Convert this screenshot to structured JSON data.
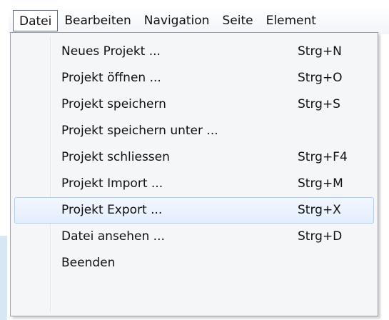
{
  "menubar": {
    "items": [
      {
        "label": "Datei"
      },
      {
        "label": "Bearbeiten"
      },
      {
        "label": "Navigation"
      },
      {
        "label": "Seite"
      },
      {
        "label": "Element"
      }
    ]
  },
  "dropdown": {
    "items": [
      {
        "label": "Neues Projekt ...",
        "shortcut": "Strg+N"
      },
      {
        "label": "Projekt öffnen ...",
        "shortcut": "Strg+O"
      },
      {
        "label": "Projekt speichern",
        "shortcut": "Strg+S"
      },
      {
        "label": "Projekt speichern unter ...",
        "shortcut": ""
      },
      {
        "label": "Projekt schliessen",
        "shortcut": "Strg+F4"
      },
      {
        "label": "Projekt Import ...",
        "shortcut": "Strg+M"
      },
      {
        "label": "Projekt Export ...",
        "shortcut": "Strg+X"
      },
      {
        "label": "Datei ansehen ...",
        "shortcut": "Strg+D"
      },
      {
        "label": "Beenden",
        "shortcut": ""
      }
    ]
  }
}
